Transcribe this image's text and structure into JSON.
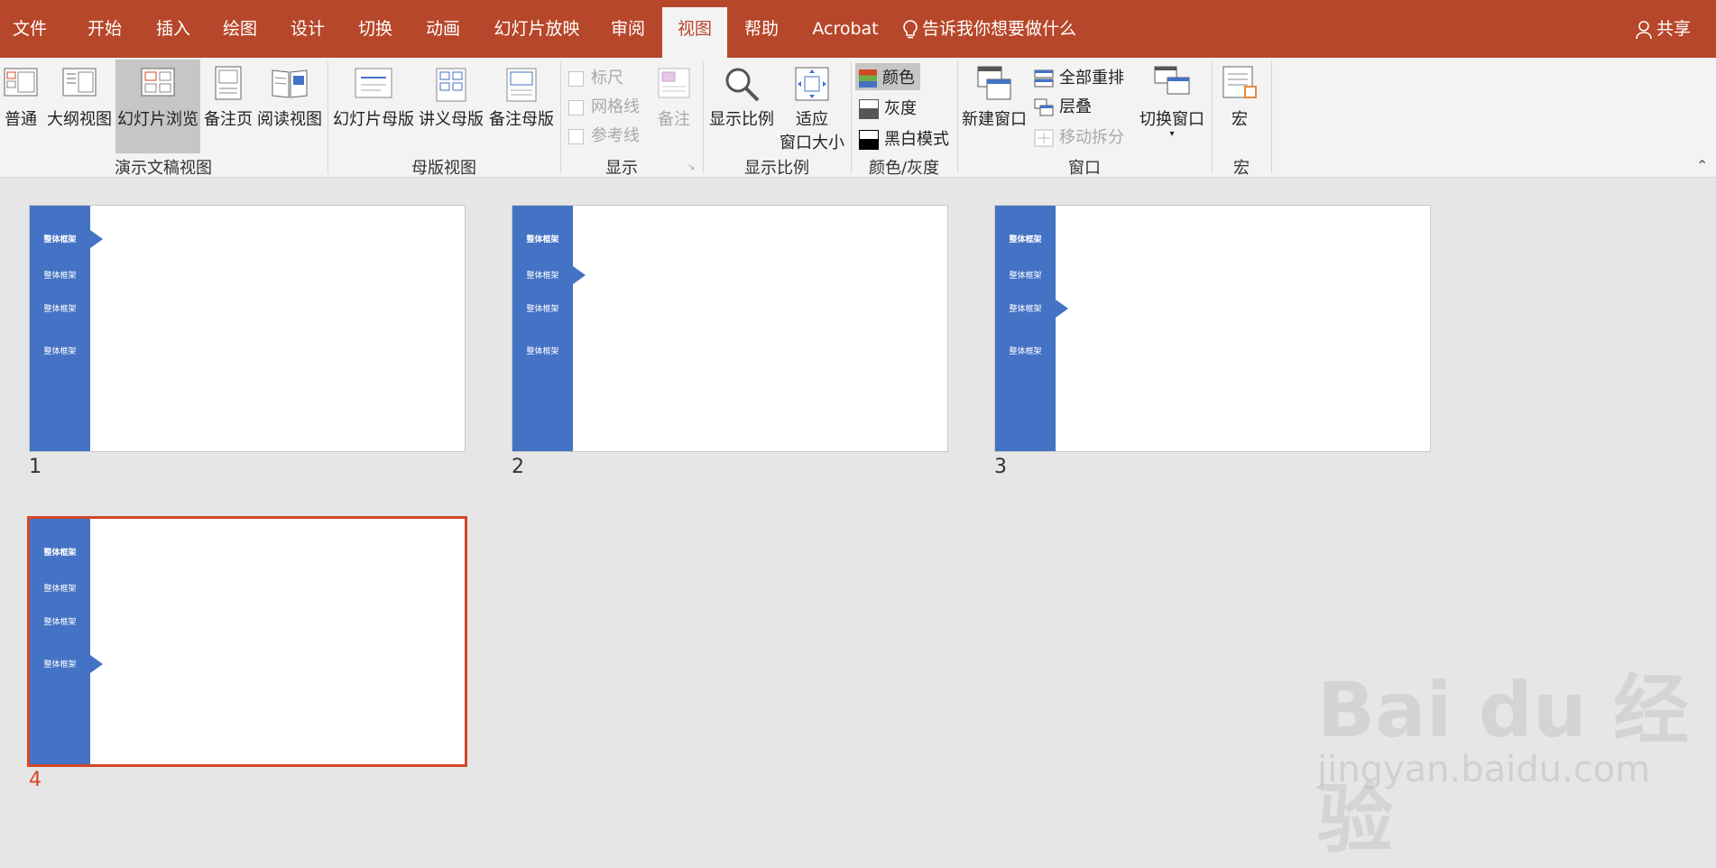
{
  "tabs": [
    "文件",
    "开始",
    "插入",
    "绘图",
    "设计",
    "切换",
    "动画",
    "幻灯片放映",
    "审阅",
    "视图",
    "帮助",
    "Acrobat"
  ],
  "active_tab": "视图",
  "tell_me": "告诉我你想要做什么",
  "share": "共享",
  "ribbon": {
    "views": {
      "normal": "普通",
      "outline": "大纲视图",
      "sorter": "幻灯片浏览",
      "notes_page": "备注页",
      "reading": "阅读视图",
      "group": "演示文稿视图"
    },
    "master": {
      "slide_master": "幻灯片母版",
      "handout_master": "讲义母版",
      "notes_master": "备注母版",
      "group": "母版视图"
    },
    "show": {
      "ruler": "标尺",
      "gridlines": "网格线",
      "guides": "参考线",
      "notes": "备注",
      "group": "显示"
    },
    "zoom": {
      "zoom": "显示比例",
      "fit_line1": "适应",
      "fit_line2": "窗口大小",
      "group": "显示比例"
    },
    "color": {
      "color": "颜色",
      "grayscale": "灰度",
      "bw": "黑白模式",
      "group": "颜色/灰度"
    },
    "window": {
      "new_window": "新建窗口",
      "arrange_all": "全部重排",
      "cascade": "层叠",
      "move_split": "移动拆分",
      "switch": "切换窗口",
      "group": "窗口"
    },
    "macros": {
      "macro": "宏",
      "group": "宏"
    }
  },
  "slides": [
    {
      "number": "1",
      "items": [
        "整体框架",
        "整体框架",
        "整体框架",
        "整体框架"
      ],
      "active_index": 0
    },
    {
      "number": "2",
      "items": [
        "整体框架",
        "整体框架",
        "整体框架",
        "整体框架"
      ],
      "active_index": 1
    },
    {
      "number": "3",
      "items": [
        "整体框架",
        "整体框架",
        "整体框架",
        "整体框架"
      ],
      "active_index": 2
    },
    {
      "number": "4",
      "items": [
        "整体框架",
        "整体框架",
        "整体框架",
        "整体框架"
      ],
      "active_index": 3
    }
  ],
  "selected_slide": "4",
  "watermark": {
    "logo": "Bai du 经验",
    "url": "jingyan.baidu.com"
  },
  "colors": {
    "accent": "#b7472a",
    "selection": "#d24726",
    "slide_bar": "#4472c4"
  }
}
